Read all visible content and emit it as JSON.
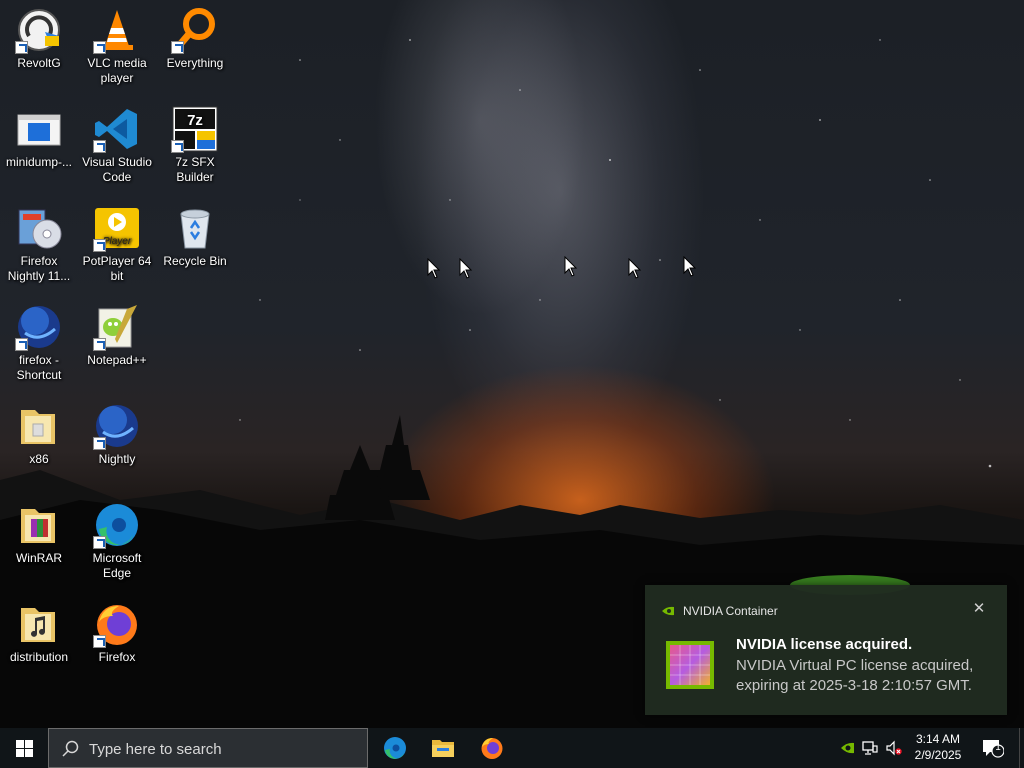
{
  "desktop_icons": [
    {
      "label": "RevoltG",
      "icon": "revolt-icon"
    },
    {
      "label": "VLC media player",
      "icon": "vlc-cone-icon"
    },
    {
      "label": "Everything",
      "icon": "everything-search-icon"
    },
    {
      "label": "minidump-...",
      "icon": "window-file-icon"
    },
    {
      "label": "Visual Studio Code",
      "icon": "vscode-icon"
    },
    {
      "label": "7z SFX Builder",
      "icon": "7z-sfx-icon"
    },
    {
      "label": "Firefox Nightly 11...",
      "icon": "installer-disc-icon"
    },
    {
      "label": "PotPlayer 64 bit",
      "icon": "potplayer-icon"
    },
    {
      "label": "Recycle Bin",
      "icon": "recycle-bin-icon"
    },
    {
      "label": "firefox - Shortcut",
      "icon": "firefox-nightly-globe-icon"
    },
    {
      "label": "Notepad++",
      "icon": "notepad-plus-plus-icon"
    },
    {
      "label": "x86",
      "icon": "folder-icon"
    },
    {
      "label": "Nightly",
      "icon": "firefox-nightly-globe-icon"
    },
    {
      "label": "WinRAR",
      "icon": "winrar-folder-icon"
    },
    {
      "label": "Microsoft Edge",
      "icon": "edge-icon"
    },
    {
      "label": "distribution",
      "icon": "music-folder-icon"
    },
    {
      "label": "Firefox",
      "icon": "firefox-icon"
    }
  ],
  "notification": {
    "app_name": "NVIDIA Container",
    "title": "NVIDIA license acquired.",
    "body": "NVIDIA Virtual PC license acquired, expiring at 2025-3-18 2:10:57 GMT.",
    "close_icon": "close-icon"
  },
  "taskbar": {
    "search_placeholder": "Type here to search",
    "pinned_apps": [
      "edge-icon",
      "file-explorer-icon",
      "firefox-icon"
    ],
    "tray_icons": [
      "nvidia-icon",
      "network-icon",
      "volume-muted-icon"
    ],
    "time": "3:14 AM",
    "date": "2/9/2025",
    "notification_count": "1"
  },
  "colors": {
    "taskbar_bg": "#101518",
    "toast_bg": "#202c20",
    "accent_blue": "#0078d7"
  }
}
